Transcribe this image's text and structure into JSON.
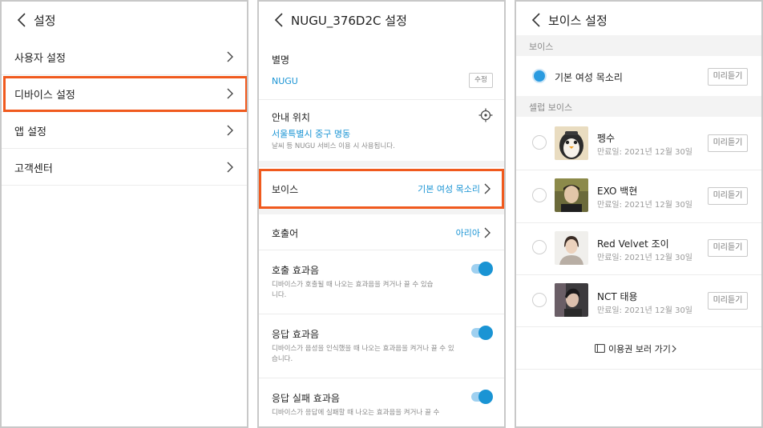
{
  "panel1": {
    "title": "설정",
    "items": [
      {
        "label": "사용자 설정"
      },
      {
        "label": "디바이스 설정",
        "highlighted": true
      },
      {
        "label": "앱 설정"
      },
      {
        "label": "고객센터"
      }
    ]
  },
  "panel2": {
    "title": "NUGU_376D2C 설정",
    "alias": {
      "label": "별명",
      "value": "NUGU",
      "edit_label": "수정"
    },
    "location": {
      "label": "안내 위치",
      "value": "서울특별시 중구 명동",
      "desc": "날씨 등 NUGU 서비스 이용 시 사용됩니다."
    },
    "voice": {
      "label": "보이스",
      "value": "기본 여성 목소리",
      "highlighted": true
    },
    "wake_word": {
      "label": "호출어",
      "value": "아리아"
    },
    "toggles": [
      {
        "label": "호출 효과음",
        "desc": "디바이스가 호출될 때 나오는 효과음을 켜거나 끌 수 있습니다.",
        "on": true
      },
      {
        "label": "응답 효과음",
        "desc": "디바이스가 음성을 인식했을 때 나오는 효과음을 켜거나 끌 수 있습니다.",
        "on": true
      },
      {
        "label": "응답 실패 효과음",
        "desc": "디바이스가 응답에 실패할 때 나오는 효과음을 켜거나 끌 수",
        "on": true
      }
    ]
  },
  "panel3": {
    "title": "보이스 설정",
    "voice_section": "보이스",
    "default_voice": {
      "name": "기본 여성 목소리",
      "selected": true,
      "preview_label": "미리듣기"
    },
    "celeb_section": "셀럽 보이스",
    "celebs": [
      {
        "name": "펭수",
        "expiry": "만료일: 2021년 12월 30일",
        "preview_label": "미리듣기",
        "selected": false
      },
      {
        "name": "EXO 백현",
        "expiry": "만료일: 2021년 12월 30일",
        "preview_label": "미리듣기",
        "selected": false
      },
      {
        "name": "Red Velvet 조이",
        "expiry": "만료일: 2021년 12월 30일",
        "preview_label": "미리듣기",
        "selected": false
      },
      {
        "name": "NCT 태용",
        "expiry": "만료일: 2021년 12월 30일",
        "preview_label": "미리듣기",
        "selected": false
      }
    ],
    "ticket_link": "이용권 보러 가기"
  },
  "colors": {
    "accent": "#1a94d4",
    "highlight": "#f05a1e",
    "toggle_track": "#9fd0f0"
  }
}
